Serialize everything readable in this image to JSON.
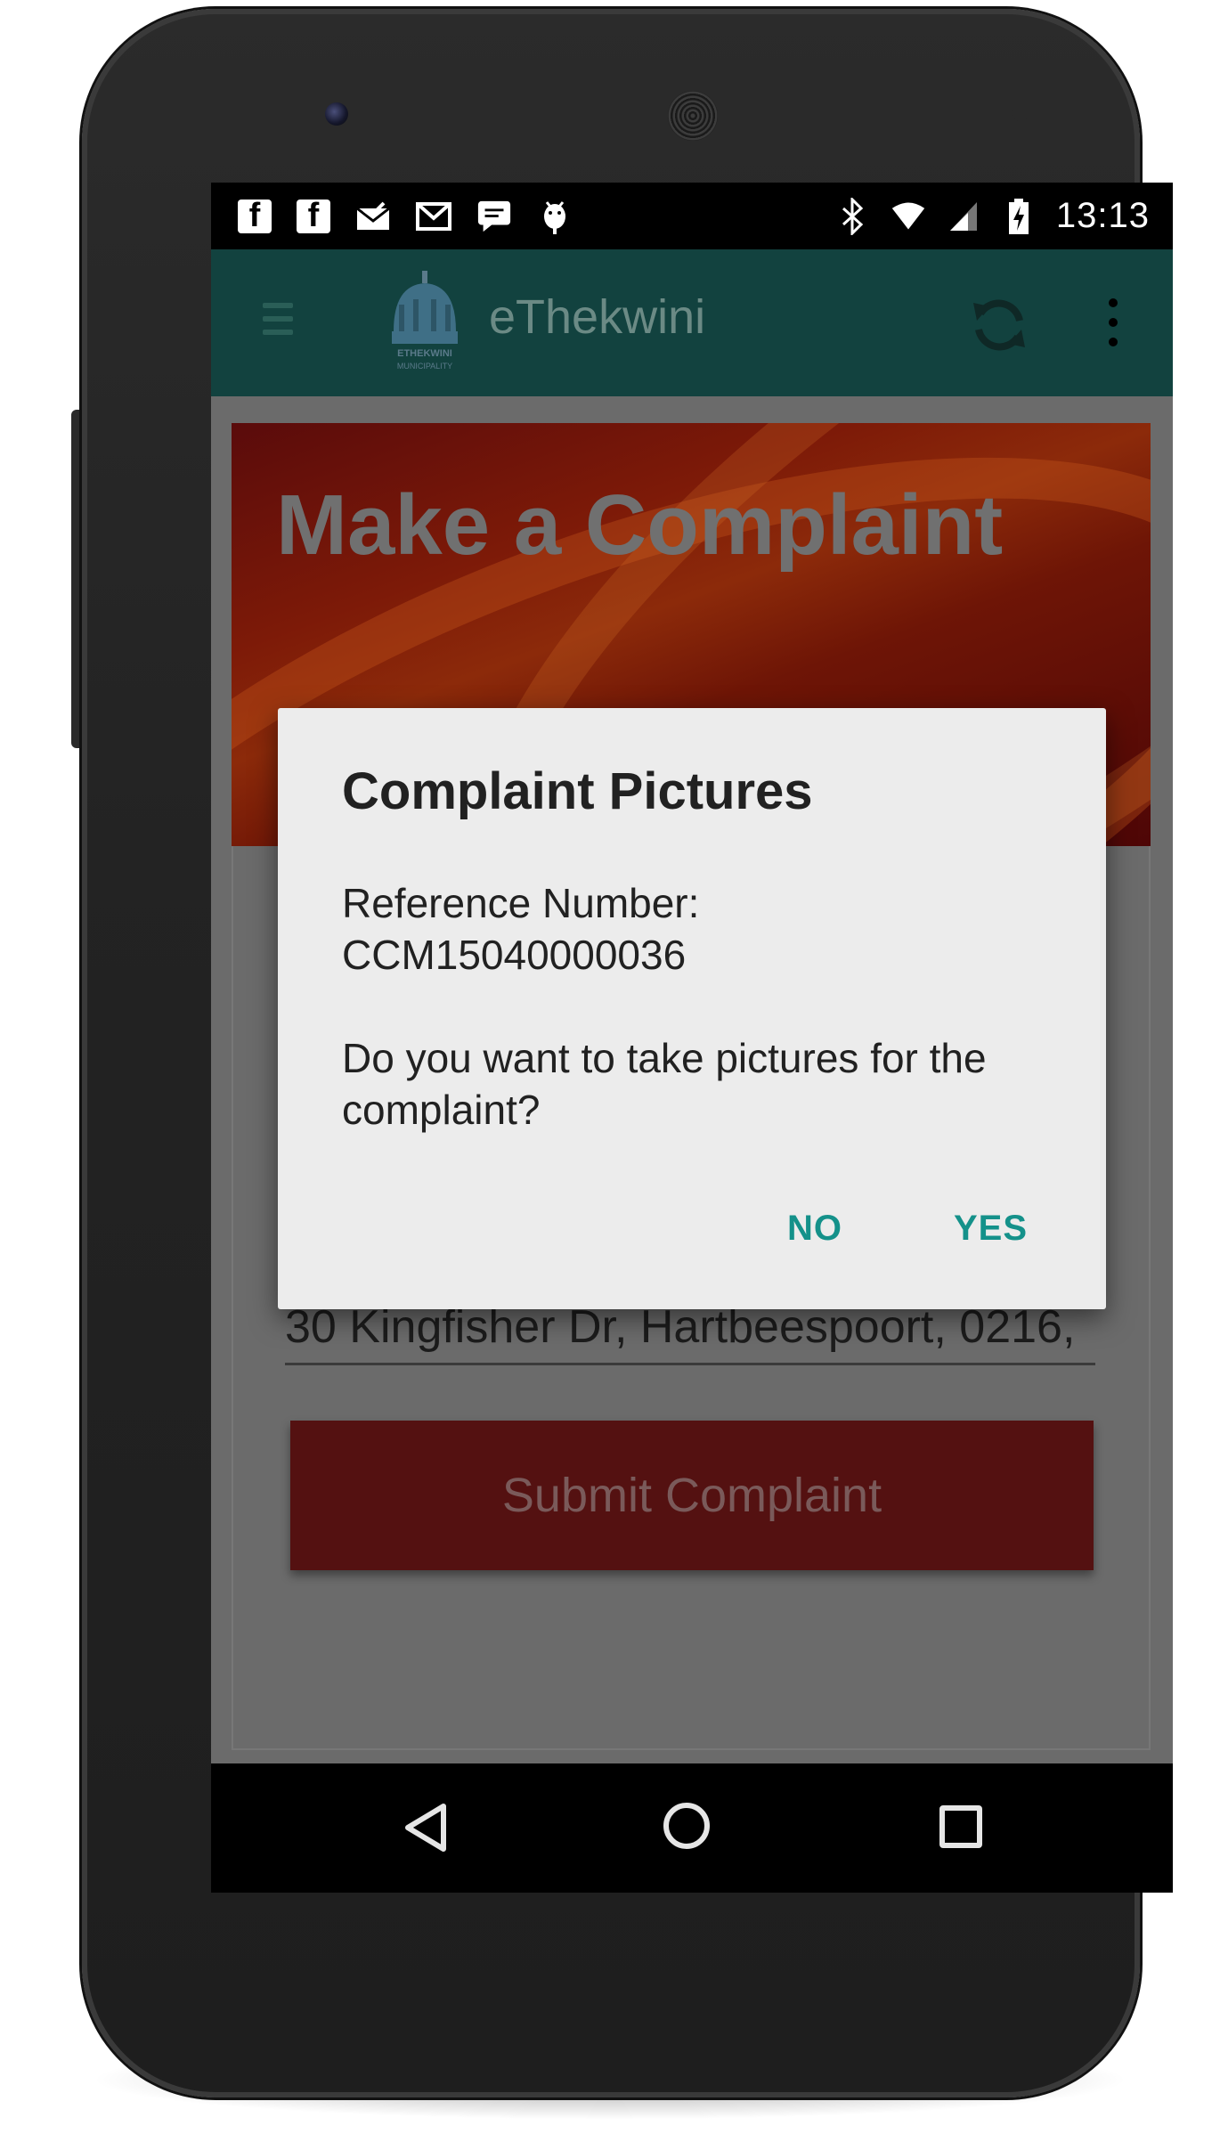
{
  "status_bar": {
    "time": "13:13",
    "left_icons": [
      "facebook-icon",
      "facebook-icon",
      "mail-icon",
      "gmail-icon",
      "chat-icon",
      "android-debug-icon"
    ],
    "right_icons": [
      "bluetooth-icon",
      "wifi-icon",
      "signal-icon",
      "battery-charging-icon"
    ]
  },
  "app_bar": {
    "title": "eThekwini",
    "logo_caption": "ETHEKWINI MUNICIPALITY"
  },
  "page": {
    "banner_title": "Make a Complaint",
    "address_value": "30 Kingfisher Dr, Hartbeespoort, 0216,",
    "submit_label": "Submit Complaint"
  },
  "dialog": {
    "title": "Complaint Pictures",
    "ref_label": "Reference Number:",
    "ref_number": "CCM15040000036",
    "question": "Do you want to take pictures for the complaint?",
    "no_label": "NO",
    "yes_label": "YES"
  },
  "colors": {
    "app_bar": "#12423f",
    "dialog_accent": "#14918a",
    "submit_button": "#541111",
    "dialog_bg": "#ececec"
  }
}
